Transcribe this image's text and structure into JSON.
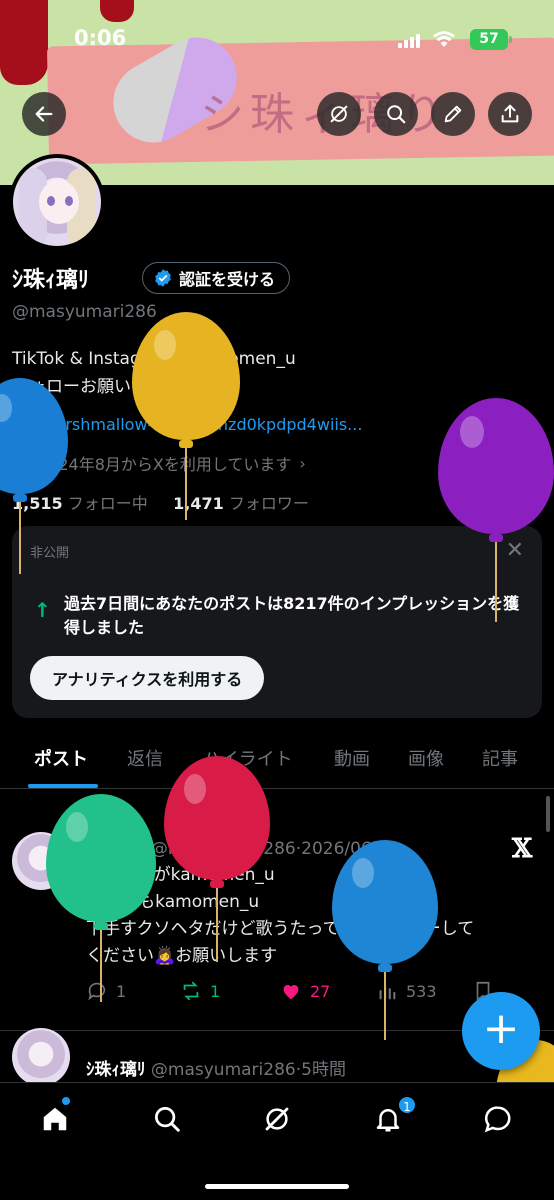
{
  "status_bar": {
    "time": "0:06",
    "battery": "57"
  },
  "banner": {
    "art_text": "シ珠ィ璃り"
  },
  "header_buttons": {
    "back": "back-arrow-icon",
    "grok": "grok-icon",
    "search": "search-icon",
    "edit": "pencil-icon",
    "share": "share-icon"
  },
  "profile": {
    "name": "ｼ珠ｨ璃ﾘ",
    "verify_label": "認証を受ける",
    "handle": "@masyumari286",
    "bio_lines": [
      "TikTok & Instagram@kamomen_u",
      "フォローお願いします"
    ],
    "link": "marshmallow-qa.com/hzd0kpdpd4wiis...",
    "joined": "2024年8月からXを利用しています",
    "following_count": "1,515",
    "following_label": "フォロー中",
    "followers_count": "1,471",
    "followers_label": "フォロワー"
  },
  "analytics_card": {
    "private_label": "非公開",
    "message": "過去7日間にあなたのポストは8217件のインプレッションを獲得しました",
    "button_label": "アナリティクスを利用する"
  },
  "tabs": [
    "ポスト",
    "返信",
    "ハイライト",
    "動画",
    "画像",
    "記事"
  ],
  "active_tab": "ポスト",
  "posts": [
    {
      "pinned_label": "固定",
      "name": "ｼ珠ｨ璃ﾘ",
      "handle": "@masyumari286",
      "date": "2026/06/09",
      "lines": [
        "インスタがkamomen_u",
        "TikTokもkamomen_u",
        "下手すクソヘタだけど歌うたってますフォローして",
        "ください🙇‍♀️お願いします"
      ],
      "replies": "1",
      "reposts": "1",
      "likes": "27",
      "views": "533"
    },
    {
      "name": "ｼ珠ｨ璃ﾘ",
      "handle": "@masyumari286",
      "date": "5時間"
    }
  ],
  "bottom_nav": {
    "items": [
      "home-icon",
      "search-icon",
      "grok-icon",
      "bell-icon",
      "messages-icon"
    ],
    "notification_badge": "1"
  },
  "colors": {
    "accent": "#1d9bf0",
    "like": "#f91880",
    "repost": "#00ba7c",
    "background": "#000000",
    "banner_green": "#c9e3a7",
    "banner_pink": "#ee9d9b"
  },
  "balloons": [
    "#1a7fd4",
    "#e6b422",
    "#8b1fbf",
    "#22c08a",
    "#d81b47",
    "#1f86d6",
    "#e8b81e"
  ]
}
